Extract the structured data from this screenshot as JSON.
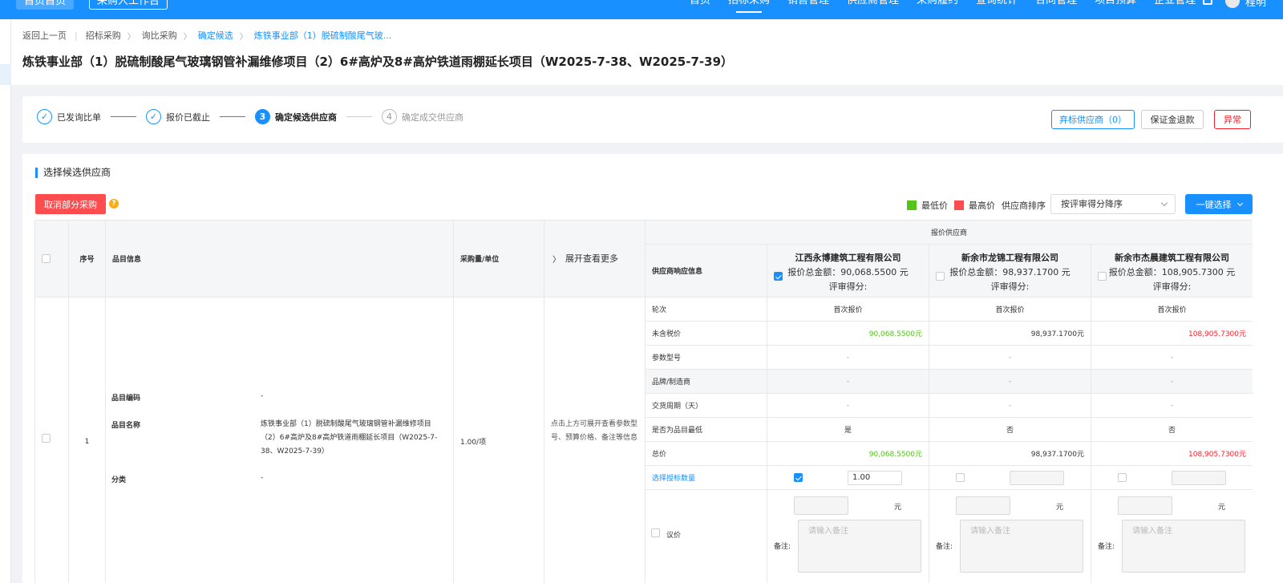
{
  "topnav": {
    "home_label": "首页首页",
    "workbench_label": "采购人工作台",
    "menu": [
      "首页",
      "招标采购",
      "销售管理",
      "供应商管理",
      "采购履约",
      "查询统计",
      "合同管理",
      "项目预算",
      "企业管理"
    ],
    "active_index": 1,
    "user_name": "程明"
  },
  "breadcrumb": {
    "back": "返回上一页",
    "items": [
      "招标采购",
      "询比采购",
      "确定候选",
      "炼铁事业部（1）脱硫制酸尾气玻..."
    ]
  },
  "page_title": "炼铁事业部（1）脱硫制酸尾气玻璃钢管补漏维修项目（2）6#高炉及8#高炉铁道雨棚延长项目（W2025-7-38、W2025-7-39）",
  "steps": [
    {
      "num": "✓",
      "label": "已发询比单",
      "state": "done"
    },
    {
      "num": "✓",
      "label": "报价已截止",
      "state": "done"
    },
    {
      "num": "3",
      "label": "确定候选供应商",
      "state": "current"
    },
    {
      "num": "4",
      "label": "确定成交供应商",
      "state": "todo"
    }
  ],
  "actions": {
    "abandon": "弃标供应商（0）",
    "deposit": "保证金退款",
    "abnormal": "异常"
  },
  "section_title": "选择候选供应商",
  "cancel_part_label": "取消部分采购",
  "help_mark": "?",
  "legend": {
    "lowest": "最低价",
    "highest": "最高价",
    "lowest_color": "#52c41a",
    "highest_color": "#ff4d4f"
  },
  "sort": {
    "label": "供应商排序",
    "value": "按评审得分降序"
  },
  "one_key_select": "一键选择",
  "table": {
    "headers": {
      "seq": "序号",
      "item_info": "品目信息",
      "qty_unit": "采购量/单位",
      "expand_more": "展开查看更多",
      "quote_suppliers": "报价供应商",
      "resp_info": "供应商响应信息"
    },
    "suppliers": [
      {
        "name": "江西永博建筑工程有限公司",
        "total": "报价总金额：90,068.5500 元",
        "score": "评审得分:",
        "checked": true
      },
      {
        "name": "新余市龙锦工程有限公司",
        "total": "报价总金额：98,937.1700 元",
        "score": "评审得分:",
        "checked": false
      },
      {
        "name": "新余市杰晨建筑工程有限公司",
        "total": "报价总金额：108,905.7300 元",
        "score": "评审得分:",
        "checked": false
      }
    ],
    "row": {
      "seq": "1",
      "code_label": "品目编码",
      "code_value": "-",
      "name_label": "品目名称",
      "name_value": "炼铁事业部（1）脱硫制酸尾气玻璃钢管补漏维修项目（2）6#高炉及8#高炉铁道雨棚延长项目（W2025-7-38、W2025-7-39）",
      "cat_label": "分类",
      "cat_value": "-",
      "qty": "1.00/项",
      "expand_hint": "点击上方可展开查看参数型号、预算价格、备注等信息"
    },
    "attrs": [
      {
        "label": "轮次",
        "values": [
          "首次报价",
          "首次报价",
          "首次报价"
        ],
        "kind": "center"
      },
      {
        "label": "未含税价",
        "values": [
          "90,068.5500元",
          "98,937.1700元",
          "108,905.7300元"
        ],
        "kind": "price"
      },
      {
        "label": "参数型号",
        "values": [
          "-",
          "-",
          "-"
        ],
        "kind": "center"
      },
      {
        "label": "品牌/制造商",
        "values": [
          "-",
          "-",
          "-"
        ],
        "kind": "center",
        "shaded": true
      },
      {
        "label": "交货周期（天）",
        "values": [
          "-",
          "-",
          "-"
        ],
        "kind": "center"
      },
      {
        "label": "是否为品目最低",
        "values": [
          "是",
          "否",
          "否"
        ],
        "kind": "center"
      },
      {
        "label": "总价",
        "values": [
          "90,068.5500元",
          "98,937.1700元",
          "108,905.7300元"
        ],
        "kind": "price"
      }
    ],
    "select_qty_label": "选择授标数量",
    "select_qty_values": [
      "1.00",
      "",
      ""
    ],
    "negotiate_label": "议价",
    "yuan": "元",
    "remark_label": "备注:",
    "remark_placeholder": "请输入备注"
  }
}
